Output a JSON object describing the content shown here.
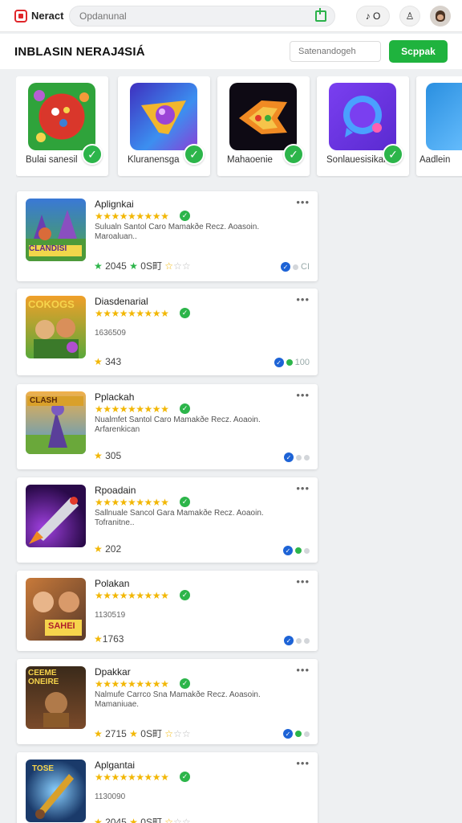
{
  "topbar": {
    "brand": "Neract",
    "search_placeholder": "Opdanunal",
    "icon_pair": "♪ O",
    "icon_person": "♙"
  },
  "header": {
    "title": "INBLASIN NERAJ4SIÁ",
    "input_placeholder": "Satenandogeh",
    "button_label": "Scppak"
  },
  "featured": [
    {
      "label": "Bulai sanesil",
      "art": "candy"
    },
    {
      "label": "Kluranensga",
      "art": "orb"
    },
    {
      "label": "Mahaoenie",
      "art": "flame"
    },
    {
      "label": "Sonlauesisikan",
      "art": "chat"
    },
    {
      "label": "Aadlein",
      "art": "blue"
    }
  ],
  "cards": [
    {
      "title": "Aplignkai",
      "desc": "Sulualn Santol Caro Mamakðe Recz. Aoasoin. Maroaluan..",
      "sub": "",
      "rating": "2045",
      "rating_extra": "0S町",
      "status": "CI",
      "art": "castle",
      "art_text": "CLANDISI"
    },
    {
      "title": "Diasdenarial",
      "desc": "",
      "sub": "1636509",
      "rating": "343",
      "rating_extra": "",
      "status": "100",
      "art": "heroes",
      "art_text": "COKOGS"
    },
    {
      "title": "Pplackah",
      "desc": "Nualmfet Santol Caro Mamakðe Recz. Aoaoin. Arfarenkican",
      "sub": "",
      "rating": "305",
      "rating_extra": "",
      "status": "",
      "art": "field",
      "art_text": "CLASH"
    },
    {
      "title": "Rpoadain",
      "desc": "Sallnuale Sancol Gara Mamakðe Recz. Aoaoin. Tofranitne..",
      "sub": "",
      "rating": "202",
      "rating_extra": "",
      "status": "",
      "art": "rocket",
      "art_text": ""
    },
    {
      "title": "Polakan",
      "desc": "",
      "sub": "1130519",
      "rating": "1763",
      "rating_extra": "",
      "status": "",
      "art": "faces",
      "art_text": "SAHEI"
    },
    {
      "title": "Dpakkar",
      "desc": "Nalmufe Carrco Sna Mamakðe Recz. Aoasoin. Mamaniuae.",
      "sub": "",
      "rating": "2715",
      "rating_extra": "0S町",
      "status": "",
      "art": "warrior",
      "art_text": "CEEME ONEIRE"
    },
    {
      "title": "Aplgantai",
      "desc": "",
      "sub": "1130090",
      "rating": "2045",
      "rating_extra": "0S町",
      "status": "",
      "art": "sword",
      "art_text": "TOSE"
    }
  ],
  "colors": {
    "accent_green": "#1fb33e",
    "brand_red": "#e0262a",
    "star_gold": "#f2b705",
    "verify_blue": "#1d63d6"
  }
}
